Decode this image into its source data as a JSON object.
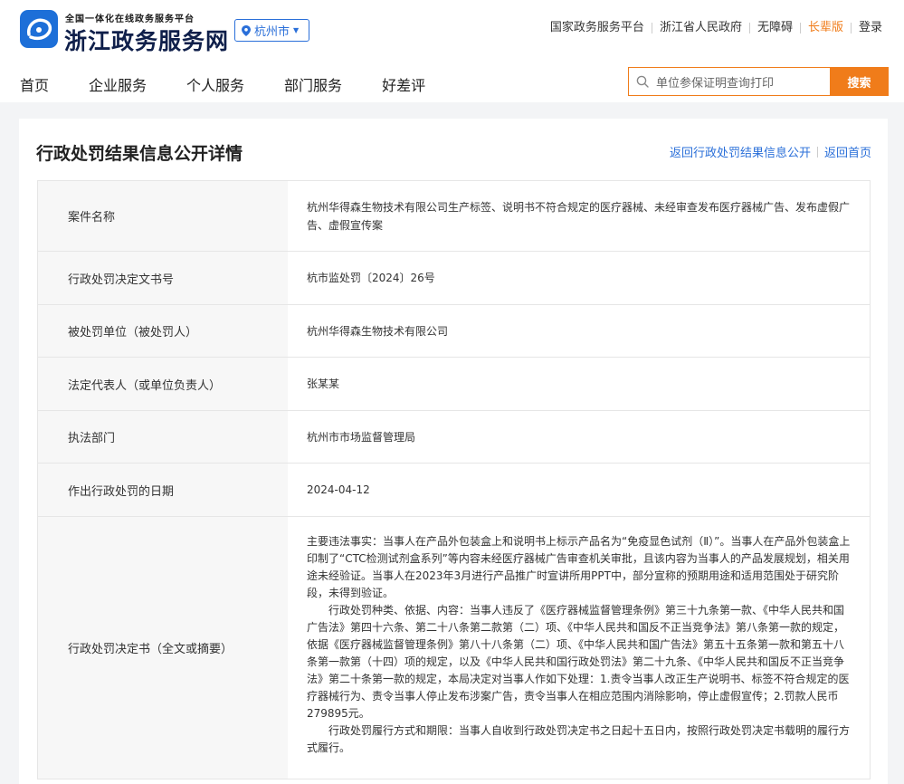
{
  "header": {
    "brand_sub": "全国一体化在线政务服务平台",
    "brand_main": "浙江政务服务网",
    "city": "杭州市",
    "top_links": [
      "国家政务服务平台",
      "浙江省人民政府",
      "无障碍",
      "长辈版",
      "登录"
    ],
    "nav": [
      "首页",
      "企业服务",
      "个人服务",
      "部门服务",
      "好差评"
    ],
    "search_placeholder": "单位参保证明查询打印",
    "search_button": "搜索"
  },
  "page": {
    "title": "行政处罚结果信息公开详情",
    "link_back_list": "返回行政处罚结果信息公开",
    "link_home": "返回首页"
  },
  "rows": [
    {
      "key": "案件名称",
      "value": "杭州华得森生物技术有限公司生产标签、说明书不符合规定的医疗器械、未经审查发布医疗器械广告、发布虚假广告、虚假宣传案"
    },
    {
      "key": "行政处罚决定文书号",
      "value": "杭市监处罚〔2024〕26号"
    },
    {
      "key": "被处罚单位（被处罚人）",
      "value": "杭州华得森生物技术有限公司"
    },
    {
      "key": "法定代表人（或单位负责人）",
      "value": "张某某"
    },
    {
      "key": "执法部门",
      "value": "杭州市市场监督管理局"
    },
    {
      "key": "作出行政处罚的日期",
      "value": "2024-04-12"
    }
  ],
  "decision": {
    "key": "行政处罚决定书（全文或摘要）",
    "p1": "主要违法事实：当事人在产品外包装盒上和说明书上标示产品名为“免疫显色试剂（Ⅱ）”。当事人在产品外包装盒上印制了“CTC检测试剂盒系列”等内容未经医疗器械广告审查机关审批，且该内容为当事人的产品发展规划，相关用途未经验证。当事人在2023年3月进行产品推广时宣讲所用PPT中，部分宣称的预期用途和适用范围处于研究阶段，未得到验证。",
    "p2": "行政处罚种类、依据、内容：当事人违反了《医疗器械监督管理条例》第三十九条第一款、《中华人民共和国广告法》第四十六条、第二十八条第二款第（二）项、《中华人民共和国反不正当竞争法》第八条第一款的规定，依据《医疗器械监督管理条例》第八十八条第（二）项、《中华人民共和国广告法》第五十五条第一款和第五十八条第一款第（十四）项的规定，以及《中华人民共和国行政处罚法》第二十九条、《中华人民共和国反不正当竞争法》第二十条第一款的规定，本局决定对当事人作如下处理：1.责令当事人改正生产说明书、标签不符合规定的医疗器械行为、责令当事人停止发布涉案广告，责令当事人在相应范围内消除影响，停止虚假宣传；2.罚款人民币279895元。",
    "p3": "行政处罚履行方式和期限：当事人自收到行政处罚决定书之日起十五日内，按照行政处罚决定书载明的履行方式履行。"
  }
}
